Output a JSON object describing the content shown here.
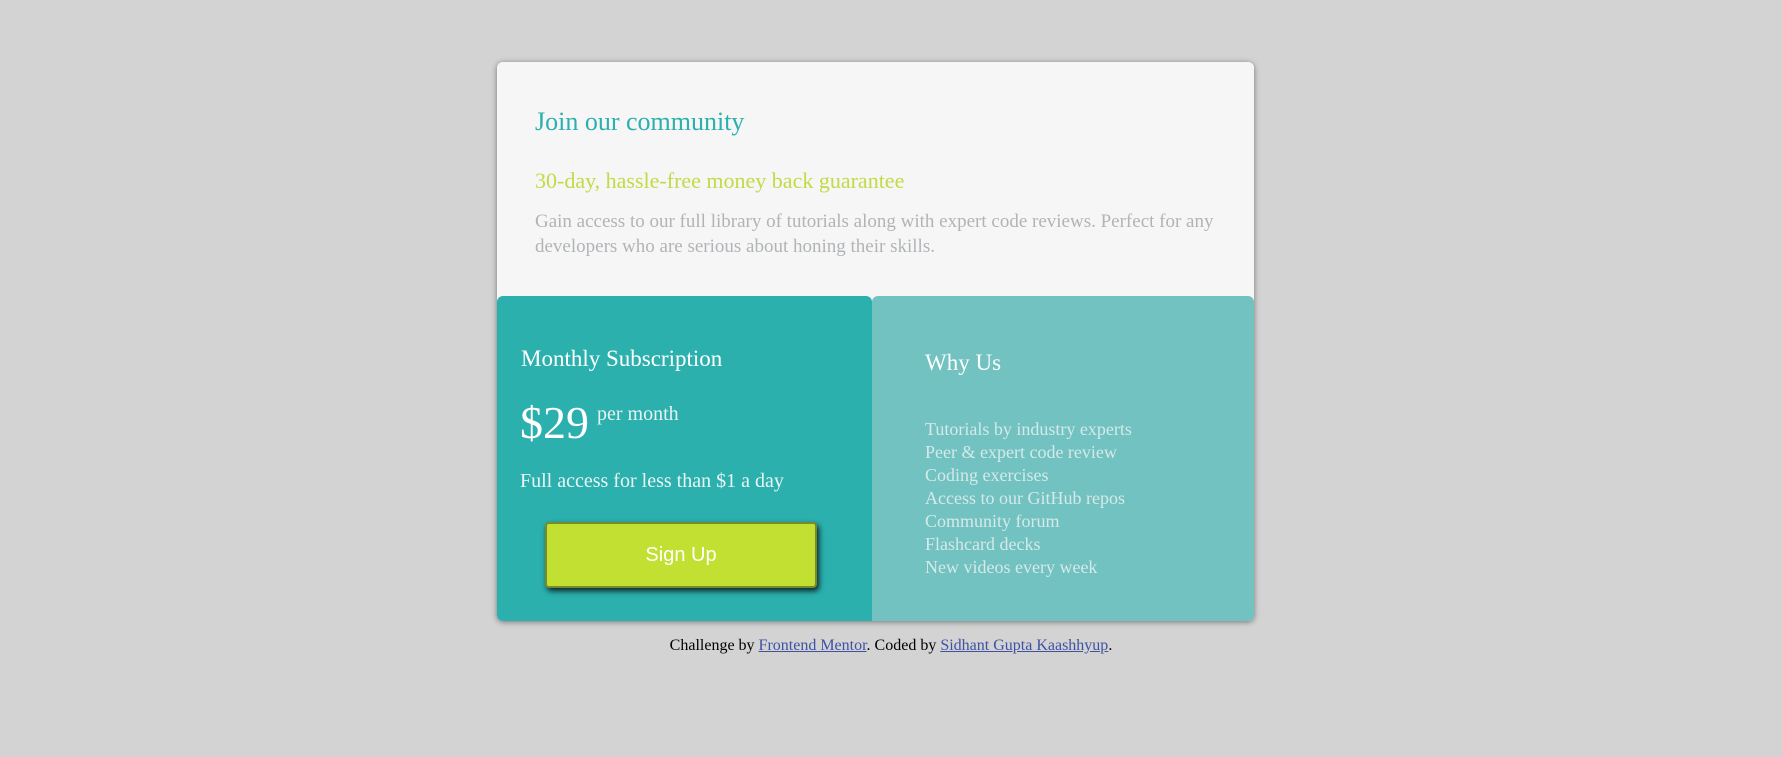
{
  "intro": {
    "title": "Join our community",
    "subtitle": "30-day, hassle-free money back guarantee",
    "description": "Gain access to our full library of tutorials along with expert code reviews. Perfect for any developers who are serious about honing their skills."
  },
  "subscription": {
    "heading": "Monthly Subscription",
    "price": "$29",
    "period": "per month",
    "note": "Full access for less than $1 a day",
    "button_label": "Sign Up"
  },
  "why_us": {
    "heading": "Why Us",
    "items": [
      "Tutorials by industry experts",
      "Peer & expert code review",
      "Coding exercises",
      "Access to our GitHub repos",
      "Community forum",
      "Flashcard decks",
      "New videos every week"
    ]
  },
  "attribution": {
    "prefix": "Challenge by ",
    "link1": "Frontend Mentor",
    "middle": ". Coded by ",
    "link2": "Sidhant Gupta Kaashhyup",
    "suffix": "."
  },
  "colors": {
    "accent": "#2bb0ae",
    "lime": "#c1e032",
    "panel": "#71c2c1",
    "background": "#d3d3d3"
  }
}
